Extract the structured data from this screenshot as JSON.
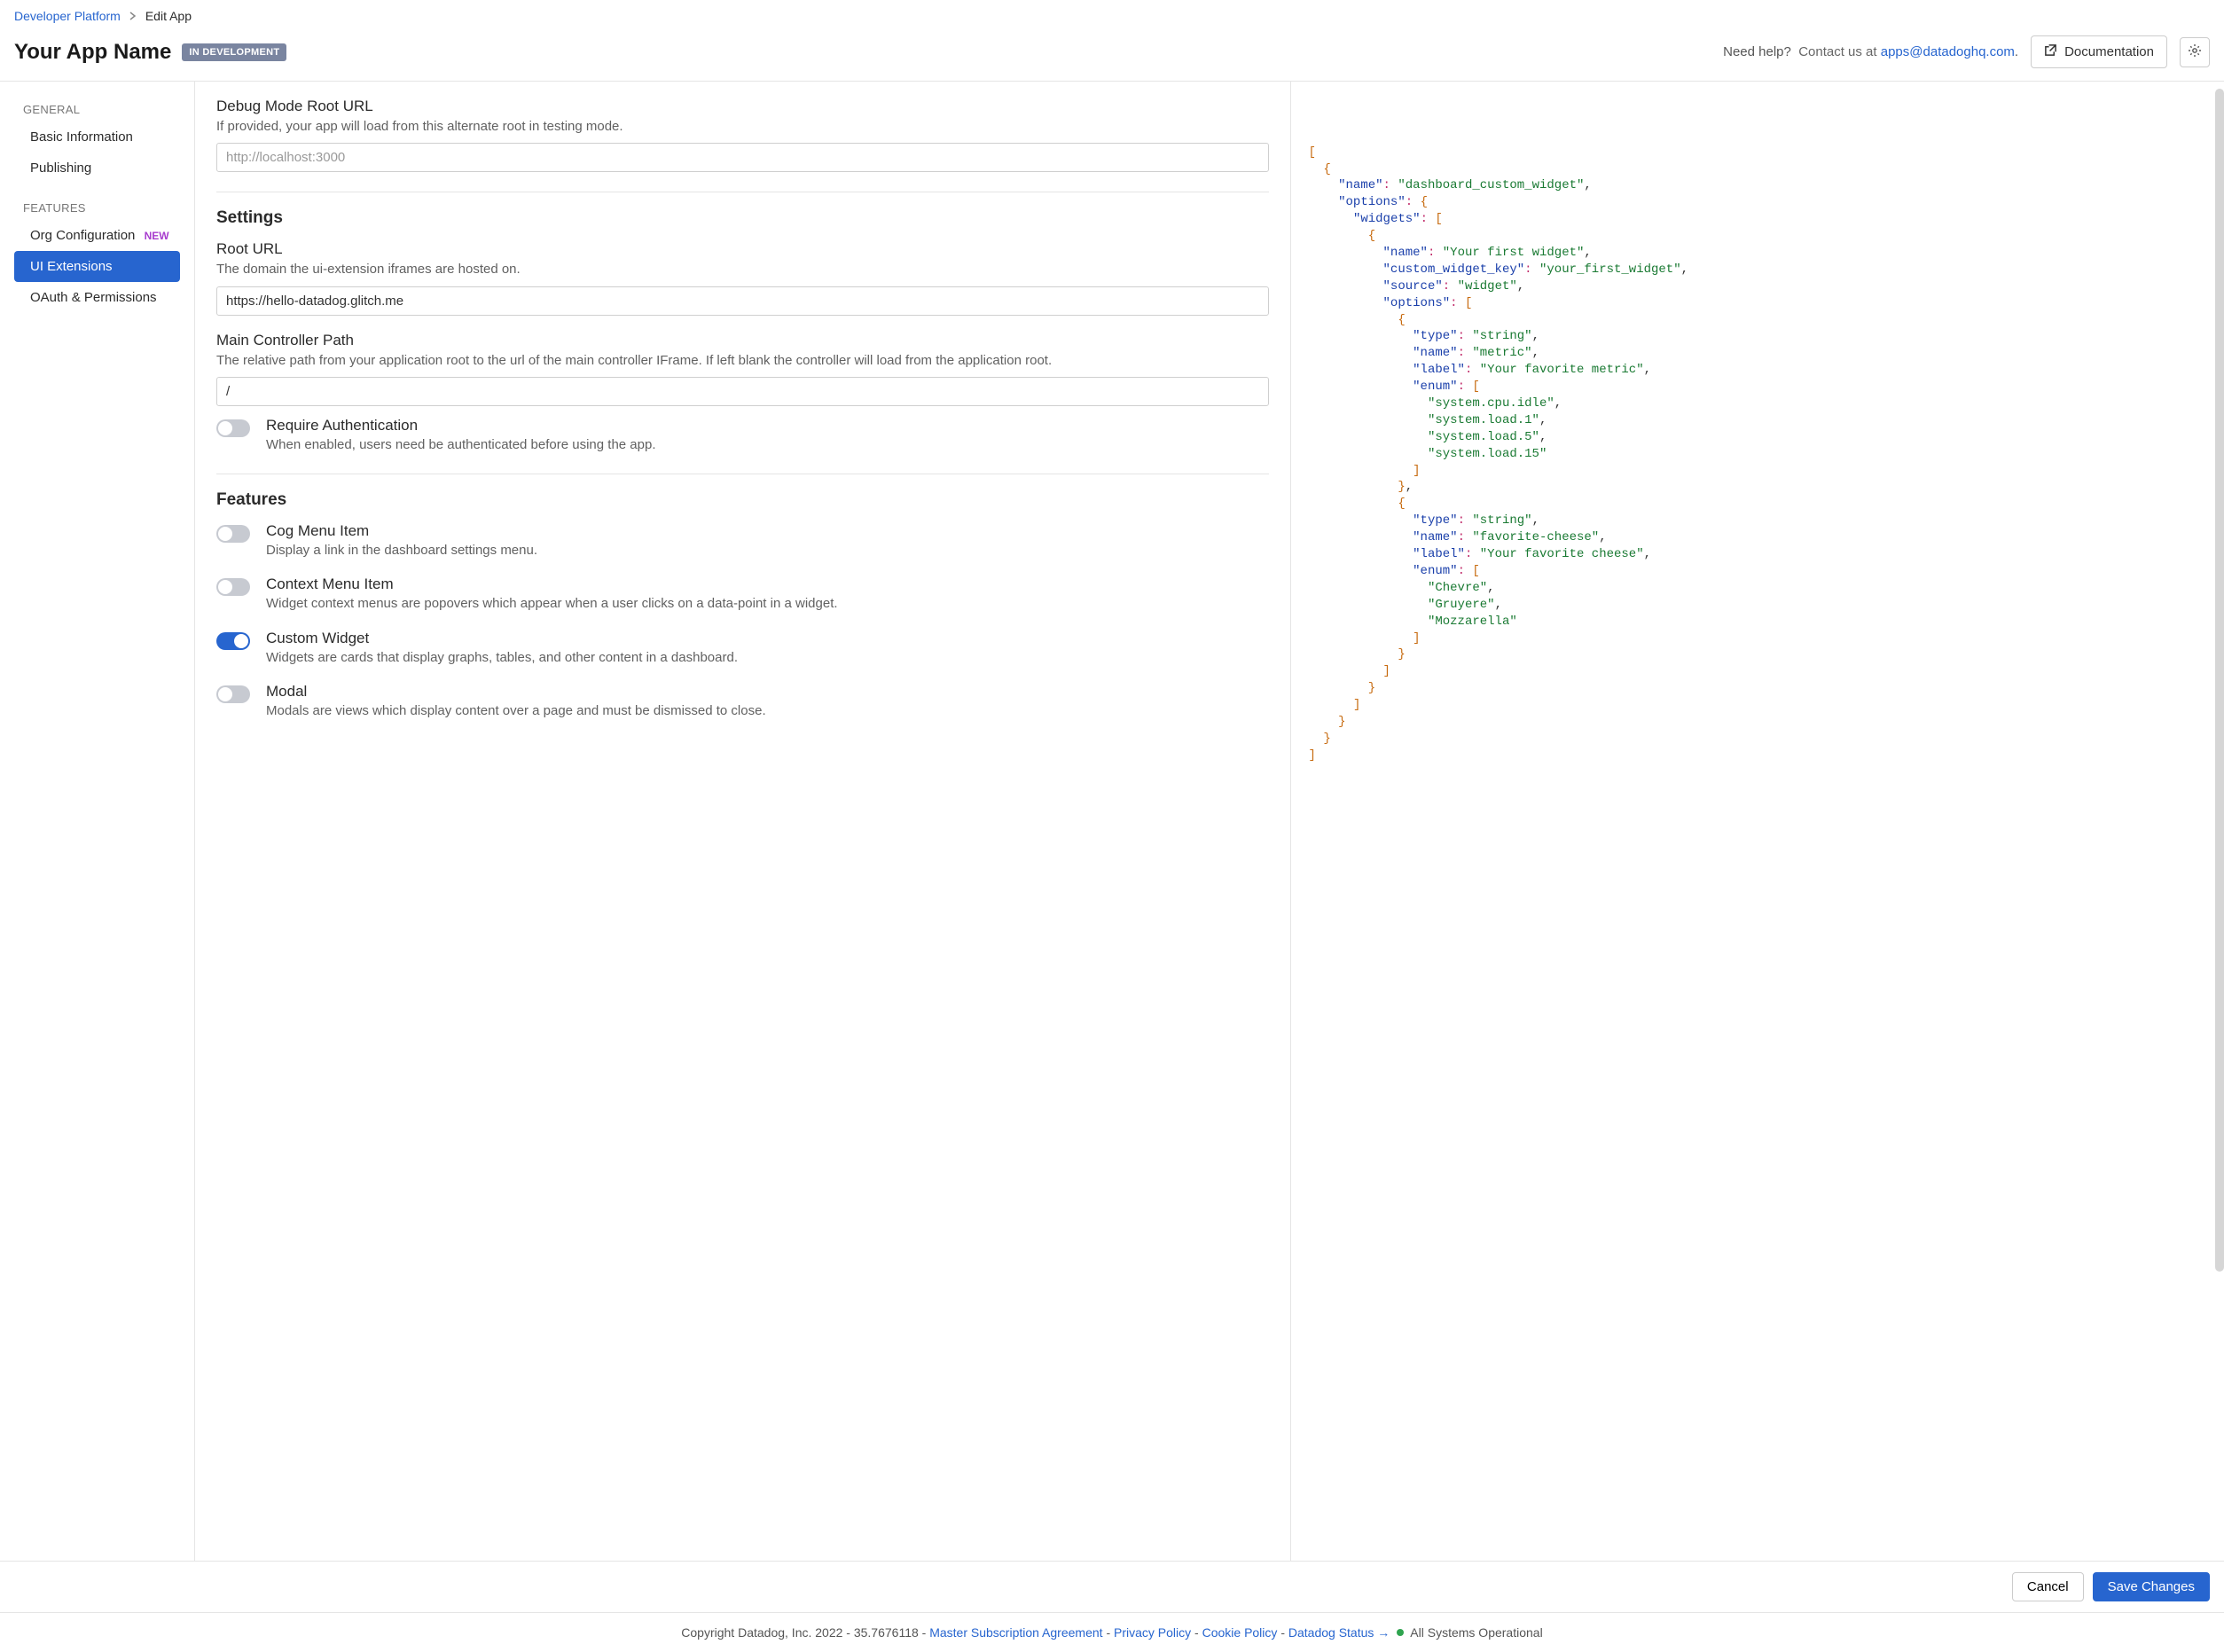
{
  "breadcrumb": {
    "root": "Developer Platform",
    "current": "Edit App"
  },
  "header": {
    "title": "Your App Name",
    "badge": "IN DEVELOPMENT",
    "need_help": "Need help?",
    "contact_prefix": "Contact us at ",
    "email": "apps@datadoghq.com",
    "email_suffix": ".",
    "doc_button": "Documentation"
  },
  "sidebar": {
    "general_label": "GENERAL",
    "features_label": "FEATURES",
    "items": {
      "basic_info": "Basic Information",
      "publishing": "Publishing",
      "org_config": "Org Configuration",
      "org_config_new": "NEW",
      "ui_ext": "UI Extensions",
      "oauth": "OAuth & Permissions"
    }
  },
  "form": {
    "debug": {
      "title": "Debug Mode Root URL",
      "desc": "If provided, your app will load from this alternate root in testing mode.",
      "placeholder": "http://localhost:3000",
      "value": ""
    },
    "settings_heading": "Settings",
    "root_url": {
      "title": "Root URL",
      "desc": "The domain the ui-extension iframes are hosted on.",
      "value": "https://hello-datadog.glitch.me"
    },
    "controller": {
      "title": "Main Controller Path",
      "desc": "The relative path from your application root to the url of the main controller IFrame. If left blank the controller will load from the application root.",
      "value": "/"
    },
    "require_auth": {
      "title": "Require Authentication",
      "desc": "When enabled, users need be authenticated before using the app.",
      "on": false
    },
    "features_heading": "Features",
    "features": [
      {
        "title": "Cog Menu Item",
        "desc": "Display a link in the dashboard settings menu.",
        "on": false
      },
      {
        "title": "Context Menu Item",
        "desc": "Widget context menus are popovers which appear when a user clicks on a data-point in a widget.",
        "on": false
      },
      {
        "title": "Custom Widget",
        "desc": "Widgets are cards that display graphs, tables, and other content in a dashboard.",
        "on": true
      },
      {
        "title": "Modal",
        "desc": "Modals are views which display content over a page and must be dismissed to close.",
        "on": false
      }
    ]
  },
  "actions": {
    "cancel": "Cancel",
    "save": "Save Changes"
  },
  "legal": {
    "copyright": "Copyright Datadog, Inc. 2022 - 35.7676118 - ",
    "msa": "Master Subscription Agreement",
    "privacy": "Privacy Policy",
    "cookie": "Cookie Policy",
    "status": "Datadog Status",
    "operational": "All Systems Operational"
  },
  "code_json": [
    {
      "name": "dashboard_custom_widget",
      "options": {
        "widgets": [
          {
            "name": "Your first widget",
            "custom_widget_key": "your_first_widget",
            "source": "widget",
            "options": [
              {
                "type": "string",
                "name": "metric",
                "label": "Your favorite metric",
                "enum": [
                  "system.cpu.idle",
                  "system.load.1",
                  "system.load.5",
                  "system.load.15"
                ]
              },
              {
                "type": "string",
                "name": "favorite-cheese",
                "label": "Your favorite cheese",
                "enum": [
                  "Chevre",
                  "Gruyere",
                  "Mozzarella"
                ]
              }
            ]
          }
        ]
      }
    }
  ]
}
